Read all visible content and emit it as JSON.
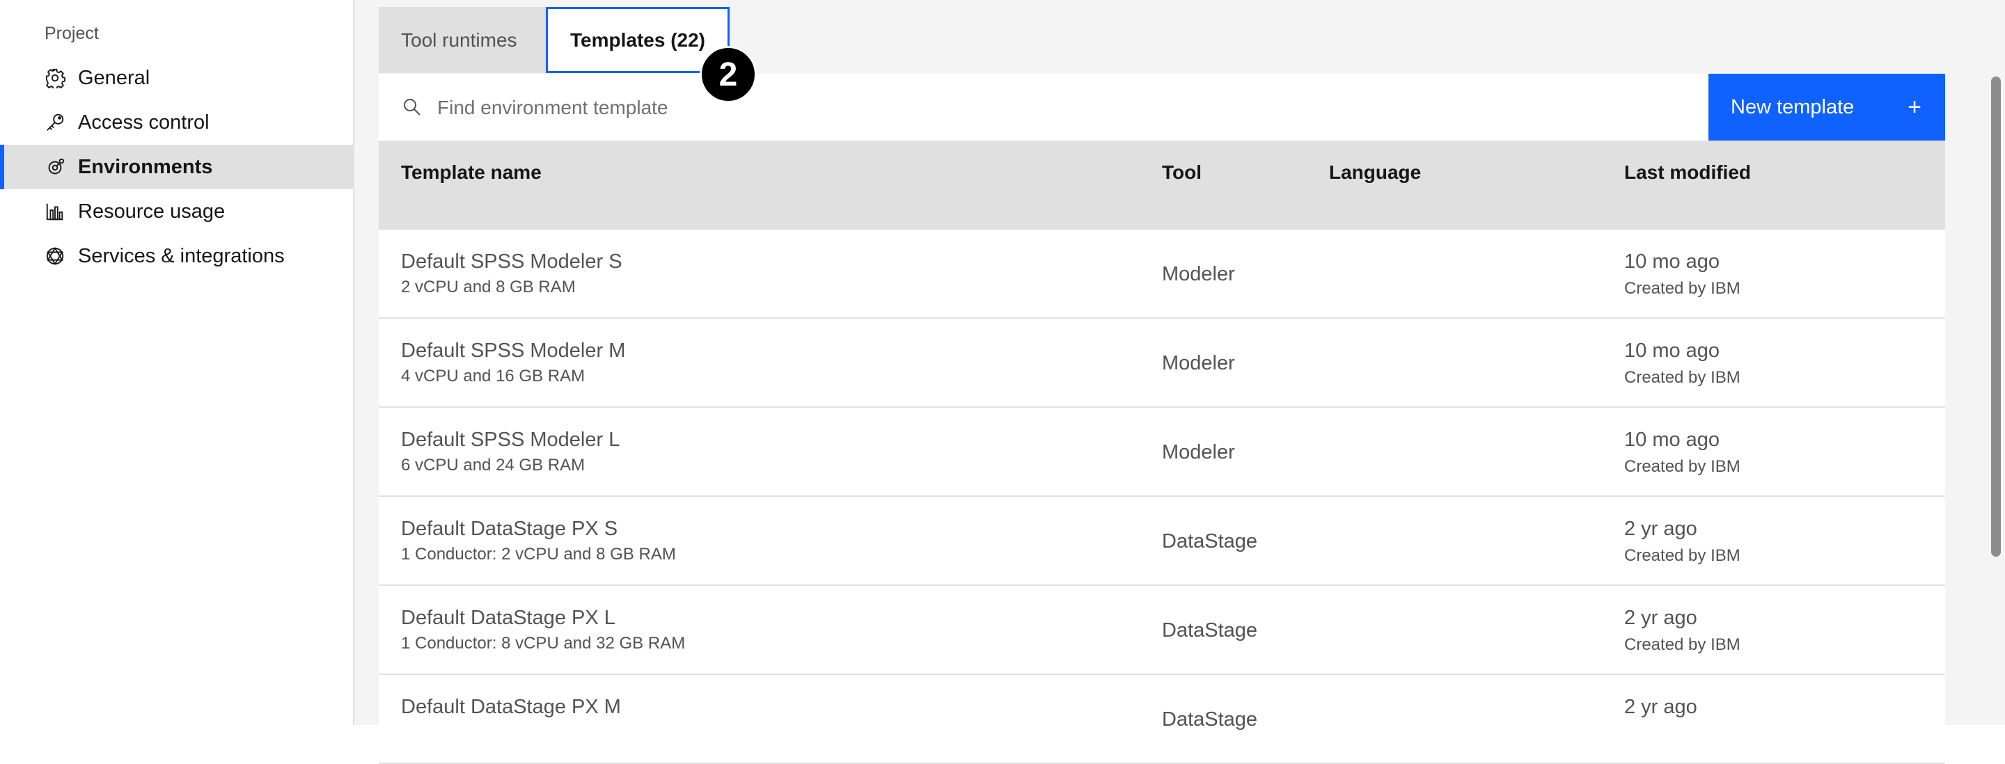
{
  "sidebar": {
    "heading": "Project",
    "items": [
      {
        "label": "General",
        "icon": "gear-icon"
      },
      {
        "label": "Access control",
        "icon": "key-icon"
      },
      {
        "label": "Environments",
        "icon": "environments-icon",
        "active": true
      },
      {
        "label": "Resource usage",
        "icon": "bar-chart-icon"
      },
      {
        "label": "Services & integrations",
        "icon": "services-icon"
      }
    ]
  },
  "tabs": [
    {
      "label": "Tool runtimes"
    },
    {
      "label": "Templates (22)",
      "selected": true
    }
  ],
  "step_badge": "2",
  "search": {
    "placeholder": "Find environment template",
    "value": ""
  },
  "new_template": {
    "label": "New template",
    "icon": "plus-icon"
  },
  "table": {
    "headers": {
      "name": "Template name",
      "tool": "Tool",
      "language": "Language",
      "modified": "Last modified"
    },
    "rows": [
      {
        "name": "Default SPSS Modeler S",
        "spec": "2 vCPU and 8 GB RAM",
        "tool": "Modeler",
        "language": "",
        "modified": "10 mo ago",
        "created": "Created by IBM"
      },
      {
        "name": "Default SPSS Modeler M",
        "spec": "4 vCPU and 16 GB RAM",
        "tool": "Modeler",
        "language": "",
        "modified": "10 mo ago",
        "created": "Created by IBM"
      },
      {
        "name": "Default SPSS Modeler L",
        "spec": "6 vCPU and 24 GB RAM",
        "tool": "Modeler",
        "language": "",
        "modified": "10 mo ago",
        "created": "Created by IBM"
      },
      {
        "name": "Default DataStage PX S",
        "spec": "1 Conductor: 2 vCPU and 8 GB RAM",
        "tool": "DataStage",
        "language": "",
        "modified": "2 yr ago",
        "created": "Created by IBM"
      },
      {
        "name": "Default DataStage PX L",
        "spec": "1 Conductor: 8 vCPU and 32 GB RAM",
        "tool": "DataStage",
        "language": "",
        "modified": "2 yr ago",
        "created": "Created by IBM"
      },
      {
        "name": "Default DataStage PX M",
        "spec": "",
        "tool": "DataStage",
        "language": "",
        "modified": "2 yr ago",
        "created": ""
      }
    ]
  },
  "colors": {
    "accent": "#0f62fe",
    "header_bg": "#e0e0e0",
    "main_bg": "#f4f4f4"
  }
}
